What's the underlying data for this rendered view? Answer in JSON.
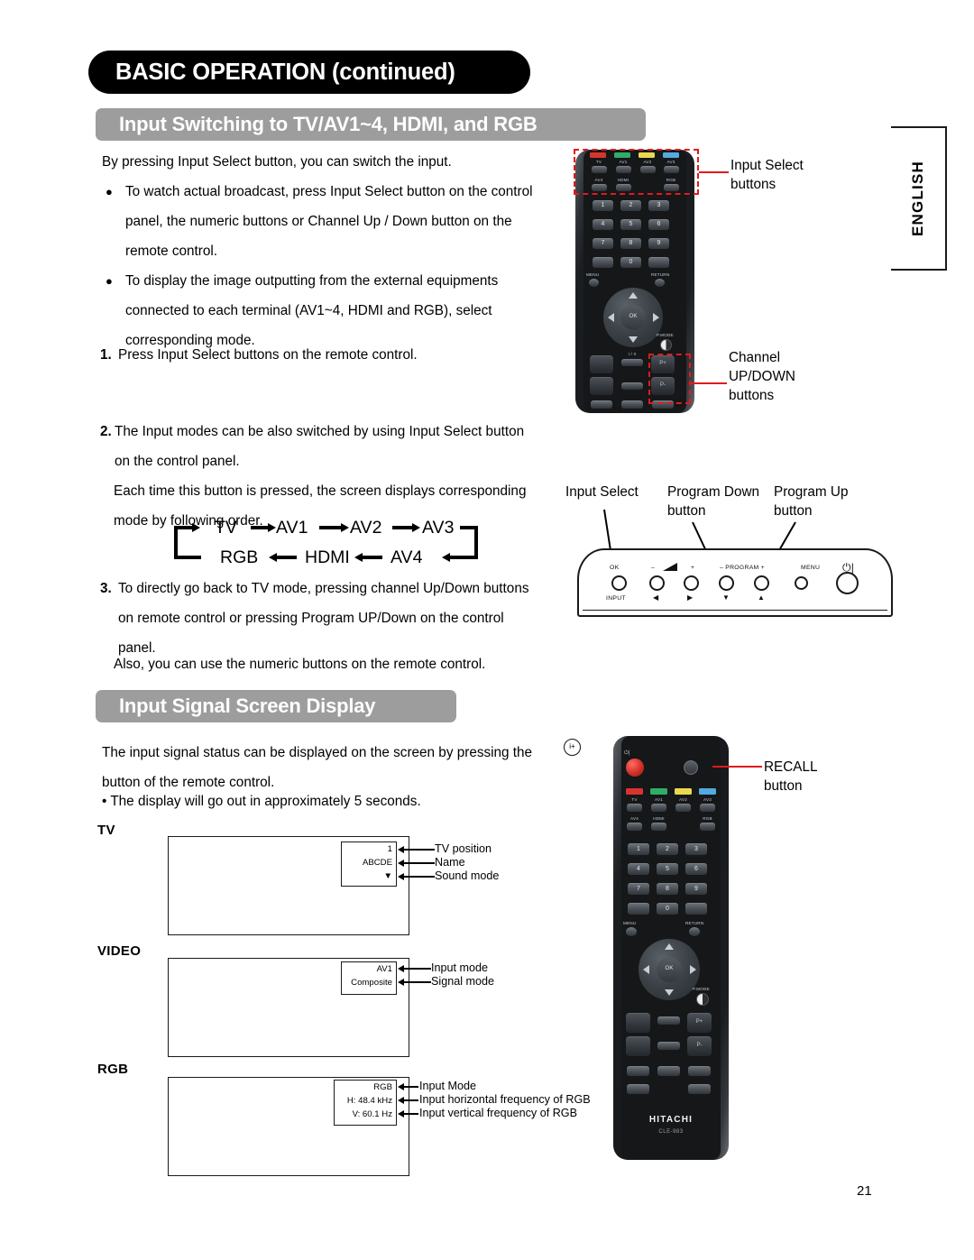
{
  "page": {
    "chapter_title": "BASIC OPERATION (continued)",
    "page_number": "21",
    "language_tab": "ENGLISH"
  },
  "sections": [
    {
      "id": "input-switching",
      "title": "Input Switching to TV/AV1~4, HDMI, and RGB"
    },
    {
      "id": "input-signal-display",
      "title": "Input Signal Screen Display"
    }
  ],
  "input_switching": {
    "intro": "By pressing Input Select button, you can switch the input.",
    "bullets": [
      "To watch actual broadcast, press Input Select button on the control\npanel, the numeric buttons or Channel Up / Down button on the\nremote control.",
      "To display the image outputting from the external equipments\nconnected to each terminal (AV1~4, HDMI and RGB), select\ncorresponding mode."
    ],
    "step1_num": "1.",
    "step1_text": "Press Input Select buttons on the remote control.",
    "step2_num": "2.",
    "step2_text": "The Input modes can be also switched by using Input Select button\non the control panel.",
    "step2_extra": "Each time this button is pressed, the screen displays corresponding\nmode by following order.",
    "step3_num": "3.",
    "step3_text": "To directly go back to TV mode, pressing channel Up/Down buttons\non remote control or pressing Program UP/Down on the control\npanel.",
    "step3_extra": "Also, you can use the numeric buttons on the remote control."
  },
  "flow_diagram": {
    "top_row": [
      "TV",
      "AV1",
      "AV2",
      "AV3"
    ],
    "bottom_row": [
      "RGB",
      "HDMI",
      "AV4"
    ]
  },
  "callouts": {
    "input_select_buttons": "Input Select\nbuttons",
    "channel_updown_buttons": "Channel\nUP/DOWN\nbuttons",
    "input_select": "Input Select",
    "program_down_button": "Program Down\nbutton",
    "program_up_button": "Program Up\nbutton",
    "recall_button": "RECALL\nbutton"
  },
  "remote_top": {
    "input_row1": [
      "TV",
      "AV1",
      "AV2",
      "AV3"
    ],
    "input_row2": [
      "AV4",
      "HDMI",
      "RGB"
    ],
    "numbers": [
      "1",
      "2",
      "3",
      "4",
      "5",
      "6",
      "7",
      "8",
      "9",
      "0"
    ],
    "menu_label": "MENU",
    "return_label": "RETURN",
    "ok_label": "OK",
    "pmode_label": "P.MODE",
    "prog_up": "P+",
    "prog_down": "P-",
    "mute_label": "I / II"
  },
  "remote_bottom": {
    "input_row1": [
      "TV",
      "AV1",
      "AV2",
      "AV3"
    ],
    "input_row2": [
      "AV4",
      "HDMI",
      "RGB"
    ],
    "numbers": [
      "1",
      "2",
      "3",
      "4",
      "5",
      "6",
      "7",
      "8",
      "9",
      "0"
    ],
    "menu_label": "MENU",
    "return_label": "RETURN",
    "ok_label": "OK",
    "pmode_label": "P.MODE",
    "prog_up": "P+",
    "prog_down": "P-",
    "brand": "HITACHI",
    "model": "CLE-983",
    "color_keys": [
      "#d8342f",
      "#2fae67",
      "#ecd84d",
      "#51abe0"
    ]
  },
  "control_panel": {
    "labels_top": [
      "OK",
      "–",
      "+",
      "– PROGRAM +",
      "MENU"
    ],
    "volume_symbol": "volume-icon",
    "power_symbol": "⏻|",
    "label_input": "INPUT",
    "arrows": [
      "◀",
      "▶",
      "▼",
      "▲"
    ]
  },
  "signal_display": {
    "intro_line1": "The input signal status can be displayed on the screen by pressing the",
    "intro_line2": "button of the remote control.",
    "bullet": "• The display will go out in approximately 5 seconds."
  },
  "osd_examples": [
    {
      "label": "TV",
      "osd_lines": [
        "1",
        "ABCDE",
        "▼"
      ],
      "annotations": [
        "TV position",
        "Name",
        "Sound mode"
      ]
    },
    {
      "label": "VIDEO",
      "osd_lines": [
        "AV1",
        "Composite"
      ],
      "annotations": [
        "Input mode",
        "Signal mode"
      ]
    },
    {
      "label": "RGB",
      "osd_lines": [
        "RGB",
        "H: 48.4 kHz",
        "V: 60.1   Hz"
      ],
      "annotations": [
        "Input Mode",
        "Input horizontal frequency of RGB",
        "Input vertical frequency of RGB"
      ]
    }
  ]
}
